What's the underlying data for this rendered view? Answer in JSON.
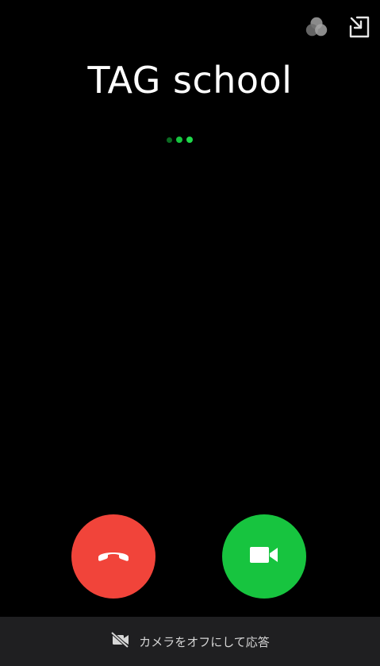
{
  "caller": {
    "name": "TAG school"
  },
  "indicator": {
    "active_color": "#1fd84a",
    "dim_color": "#0b6a22"
  },
  "top_bar": {
    "icons": [
      "effects-icon",
      "minimize-icon"
    ]
  },
  "actions": {
    "decline": {
      "icon": "phone-hangup-icon",
      "color": "#f1443a"
    },
    "accept": {
      "icon": "video-camera-icon",
      "color": "#17c43f"
    }
  },
  "bottom": {
    "label": "カメラをオフにして応答",
    "icon": "camera-off-icon"
  }
}
